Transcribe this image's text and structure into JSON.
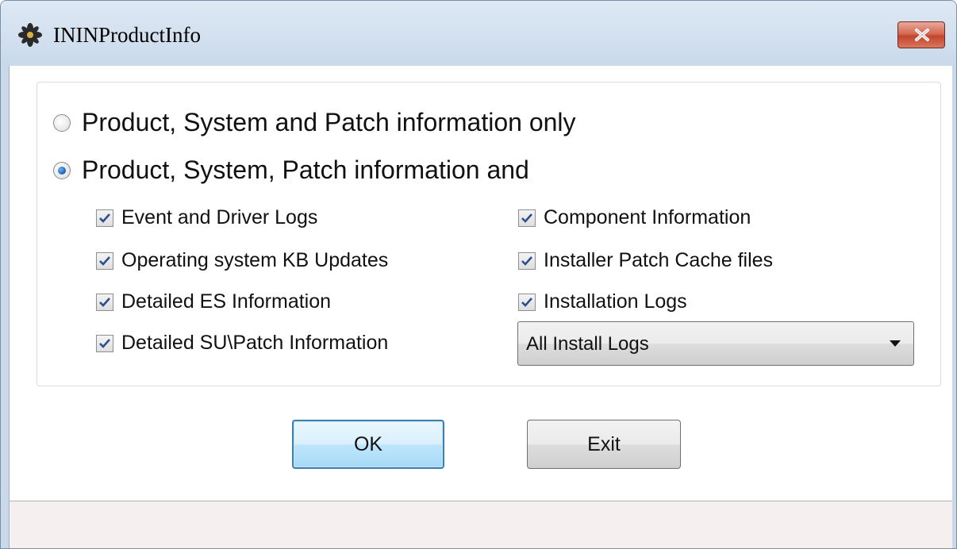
{
  "window": {
    "title": "ININProductInfo",
    "icon": "ininproductinfo-app-icon",
    "close_icon": "close-icon"
  },
  "options": {
    "radio_basic_label": "Product, System and Patch information only",
    "radio_basic_checked": false,
    "radio_extended_label": "Product, System, Patch information and",
    "radio_extended_checked": true
  },
  "checkboxes": {
    "event_driver_logs": "Event and Driver Logs",
    "os_kb_updates": "Operating system KB Updates",
    "detailed_es_info": "Detailed ES Information",
    "detailed_su_patch_info": "Detailed SU\\Patch Information",
    "component_info": "Component Information",
    "installer_patch_cache": "Installer Patch Cache files",
    "installation_logs": "Installation Logs",
    "all_checked": true
  },
  "install_logs_dropdown": {
    "selected": "All Install Logs"
  },
  "buttons": {
    "ok_label": "OK",
    "exit_label": "Exit"
  },
  "colors": {
    "title_bar": "#c9d9ea",
    "close_button": "#c2452c",
    "default_button_border": "#3c7fb1",
    "status_bar": "#f5f0ef"
  }
}
